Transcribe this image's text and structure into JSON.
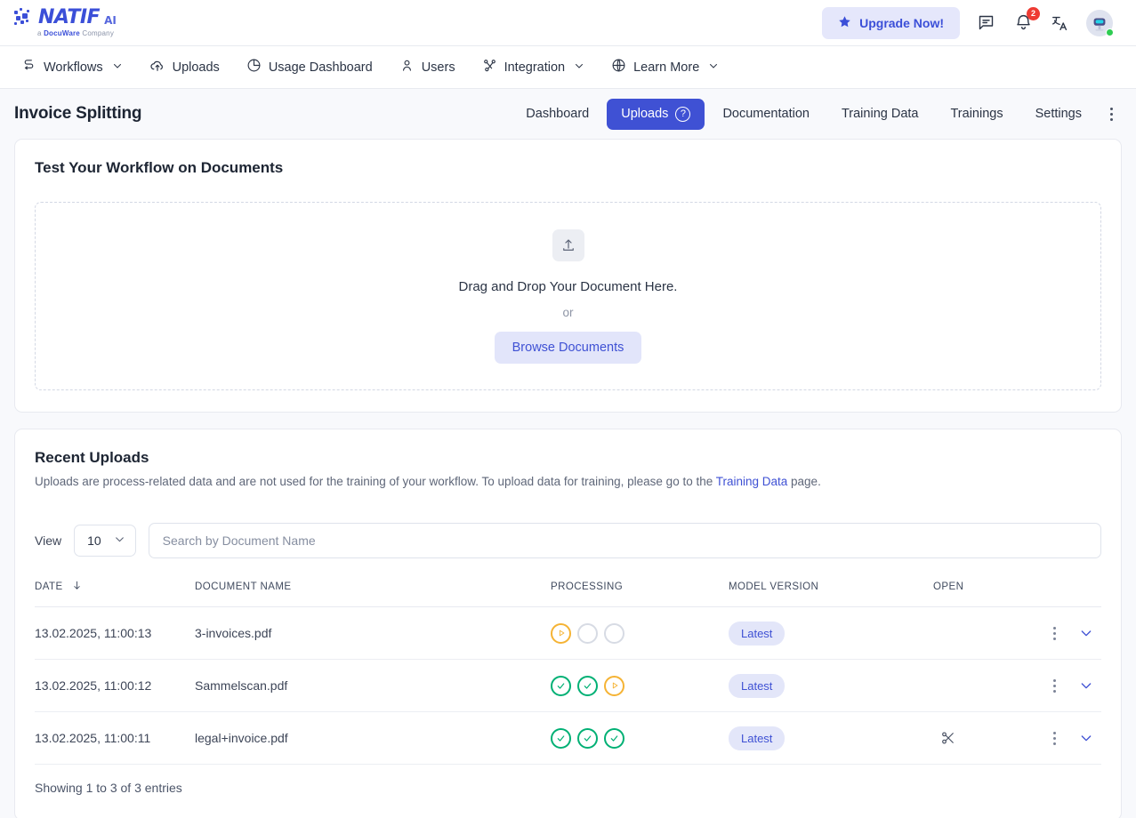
{
  "brand": {
    "name": "NATIF",
    "suffix": "AI",
    "tagline_prefix": "a ",
    "tagline_brand": "DocuWare",
    "tagline_suffix": " Company",
    "accent": "#3b4fd8"
  },
  "topbar": {
    "upgrade_label": "Upgrade Now!",
    "star_icon": "star-icon",
    "chat_icon": "chat-bubble-icon",
    "bell_icon": "notification-bell-icon",
    "notification_count": "2",
    "translate_icon": "translate-icon",
    "avatar_icon": "robot-avatar",
    "status_color": "#2ecc52"
  },
  "nav": {
    "items": [
      {
        "label": "Workflows",
        "icon": "workflow-icon",
        "caret": true
      },
      {
        "label": "Uploads",
        "icon": "cloud-upload-icon",
        "caret": false
      },
      {
        "label": "Usage Dashboard",
        "icon": "pie-chart-icon",
        "caret": false
      },
      {
        "label": "Users",
        "icon": "user-icon",
        "caret": false
      },
      {
        "label": "Integration",
        "icon": "integration-icon",
        "caret": true
      },
      {
        "label": "Learn More",
        "icon": "globe-icon",
        "caret": true
      }
    ]
  },
  "subheader": {
    "title": "Invoice Splitting",
    "tabs": [
      {
        "label": "Dashboard",
        "active": false,
        "help": false
      },
      {
        "label": "Uploads",
        "active": true,
        "help": true
      },
      {
        "label": "Documentation",
        "active": false,
        "help": false
      },
      {
        "label": "Training Data",
        "active": false,
        "help": false
      },
      {
        "label": "Trainings",
        "active": false,
        "help": false
      },
      {
        "label": "Settings",
        "active": false,
        "help": false
      }
    ],
    "overflow_icon": "kebab-menu-icon",
    "active_tab_color": "#3f51d4"
  },
  "test_card": {
    "title": "Test Your Workflow on Documents",
    "upload_icon": "upload-arrow-icon",
    "drop_text": "Drag and Drop Your Document Here.",
    "or_text": "or",
    "browse_label": "Browse Documents"
  },
  "recent": {
    "title": "Recent Uploads",
    "desc_before": "Uploads are process-related data and are not used for the training of your workflow. To upload data for training, please go to the ",
    "desc_link": "Training Data",
    "desc_after": " page.",
    "view_label": "View",
    "view_value": "10",
    "view_caret": "chevron-down-icon",
    "search_placeholder": "Search by Document Name",
    "columns": [
      "DATE",
      "DOCUMENT NAME",
      "PROCESSING",
      "MODEL VERSION",
      "OPEN"
    ],
    "sort_icon": "sort-descending-arrow",
    "rows": [
      {
        "date": "13.02.2025, 11:00:13",
        "name": "3-invoices.pdf",
        "steps": [
          "running",
          "pending",
          "pending"
        ],
        "model_version": "Latest",
        "open": "",
        "has_scissors": false
      },
      {
        "date": "13.02.2025, 11:00:12",
        "name": "Sammelscan.pdf",
        "steps": [
          "done",
          "done",
          "running"
        ],
        "model_version": "Latest",
        "open": "",
        "has_scissors": false
      },
      {
        "date": "13.02.2025, 11:00:11",
        "name": "legal+invoice.pdf",
        "steps": [
          "done",
          "done",
          "done"
        ],
        "model_version": "Latest",
        "open": "",
        "has_scissors": true
      }
    ],
    "scissors_icon": "scissors-split-icon",
    "row_menu_icon": "kebab-menu-icon",
    "expand_icon": "chevron-down-icon",
    "showing_text": "Showing 1 to 3 of 3 entries",
    "status_colors": {
      "done": "#00b074",
      "running": "#f5b334",
      "pending": "#d7dbe4"
    }
  }
}
